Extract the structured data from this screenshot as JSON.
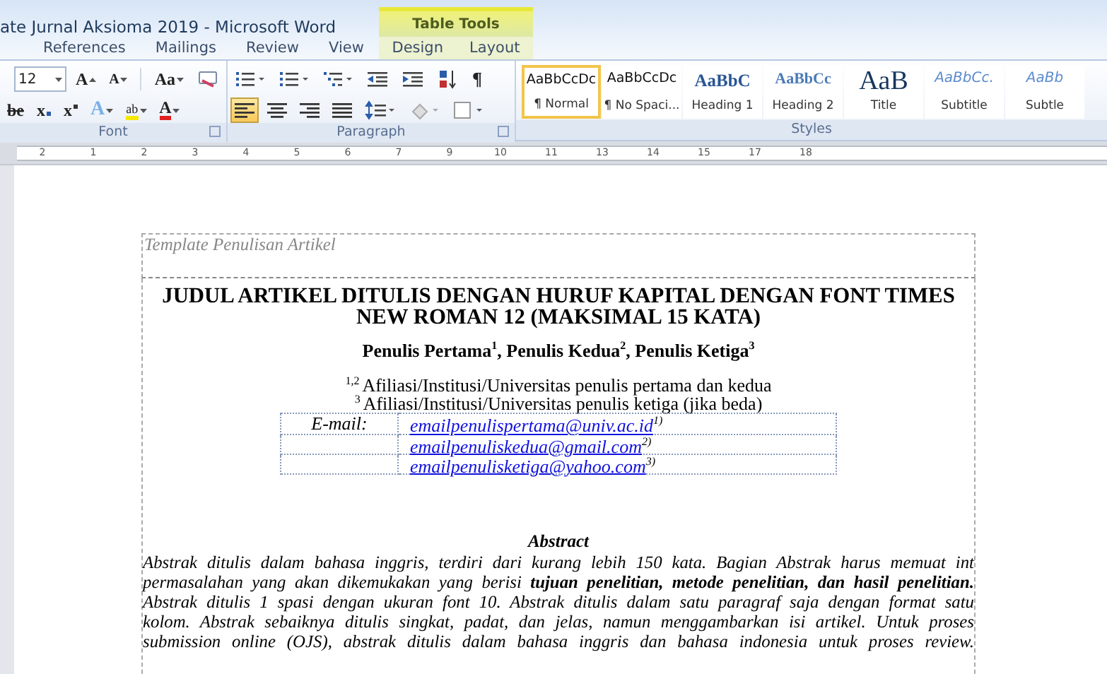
{
  "window": {
    "title": "ate Jurnal Aksioma 2019  -  Microsoft Word"
  },
  "tabs": [
    {
      "label": "References",
      "selected": false
    },
    {
      "label": "Mailings",
      "selected": false
    },
    {
      "label": "Review",
      "selected": false
    },
    {
      "label": "View",
      "selected": false
    }
  ],
  "contextual_group": {
    "label": "Table Tools",
    "tabs": [
      {
        "label": "Design",
        "selected": false
      },
      {
        "label": "Layout",
        "selected": false
      }
    ]
  },
  "font_group": {
    "label": "Font",
    "top_buttons": [
      {
        "kind": "size-field",
        "label": "12"
      },
      {
        "kind": "grow-font",
        "label": "A",
        "selected": false
      },
      {
        "kind": "shrink-font",
        "label": "A",
        "selected": false
      },
      {
        "kind": "change-case",
        "label": "Aa",
        "selected": false
      },
      {
        "kind": "clear-format",
        "selected": false
      }
    ],
    "bottom_buttons": [
      {
        "kind": "strike",
        "label": "be",
        "selected": false
      },
      {
        "kind": "subscript",
        "label": "x",
        "selected": false
      },
      {
        "kind": "superscript",
        "label": "x",
        "selected": false
      },
      {
        "kind": "text-effect",
        "label": "A",
        "selected": false
      },
      {
        "kind": "highlight",
        "label": "ab",
        "selected": false
      },
      {
        "kind": "font-color",
        "label": "A",
        "selected": false
      }
    ]
  },
  "paragraph_group": {
    "label": "Paragraph",
    "top_buttons": [
      {
        "kind": "bullets",
        "selected": false
      },
      {
        "kind": "numbering",
        "selected": false
      },
      {
        "kind": "multilevel",
        "selected": false
      },
      {
        "kind": "outdent",
        "selected": false
      },
      {
        "kind": "indent",
        "selected": false
      },
      {
        "kind": "sort",
        "selected": false
      },
      {
        "kind": "pilcrow",
        "label": "¶",
        "selected": false
      }
    ],
    "bottom_buttons": [
      {
        "kind": "align-left",
        "selected": true
      },
      {
        "kind": "align-center",
        "selected": false
      },
      {
        "kind": "align-right",
        "selected": false
      },
      {
        "kind": "justify",
        "selected": false
      },
      {
        "kind": "line-spacing",
        "selected": false
      },
      {
        "kind": "shading",
        "selected": false
      },
      {
        "kind": "borders",
        "selected": false
      }
    ]
  },
  "styles_group": {
    "label": "Styles",
    "items": [
      {
        "kind": "normal",
        "preview": "AaBbCcDc",
        "name": "¶ Normal",
        "selected": true
      },
      {
        "kind": "normal",
        "preview": "AaBbCcDc",
        "name": "¶ No Spaci...",
        "selected": false
      },
      {
        "kind": "heading1",
        "preview": "AaBbC",
        "name": "Heading 1",
        "selected": false
      },
      {
        "kind": "heading2",
        "preview": "AaBbCc",
        "name": "Heading 2",
        "selected": false
      },
      {
        "kind": "title",
        "preview": "AaB",
        "name": "Title",
        "selected": false
      },
      {
        "kind": "subtitle",
        "preview": "AaBbCc.",
        "name": "Subtitle",
        "selected": false
      },
      {
        "kind": "subtitle",
        "preview": "AaBb",
        "name": "Subtle",
        "selected": false
      }
    ]
  },
  "ruler": {
    "labels": [
      "2",
      "1",
      "2",
      "3",
      "4",
      "5",
      "6",
      "7",
      "9",
      "10",
      "11",
      "13",
      "14",
      "15",
      "17",
      "18"
    ]
  },
  "document": {
    "header": "Template Penulisan Artikel",
    "title": "JUDUL ARTIKEL DITULIS DENGAN HURUF KAPITAL DENGAN FONT TIMES NEW ROMAN 12 (MAKSIMAL 15 KATA)",
    "authors": "Penulis Pertama$^{1}$,  Penulis Kedua$^{2}$, Penulis Ketiga$^{3}$",
    "affiliations": [
      {
        "mark": "1,2",
        "text": "Afiliasi/Institusi/Universitas penulis pertama dan kedua"
      },
      {
        "mark": "3",
        "text": "Afiliasi/Institusi/Universitas penulis ketiga (jika beda)"
      }
    ],
    "email_label": "E-mail:",
    "emails": [
      {
        "address": "emailpenulispertama@univ.ac.id",
        "mark": "1)"
      },
      {
        "address": "emailpenuliskedua@gmail.com",
        "mark": "2)"
      },
      {
        "address": "emailpenulisketiga@yahoo.com",
        "mark": "3)"
      }
    ],
    "abstract_heading": "Abstract",
    "abstract_lines": [
      "Abstrak ditulis dalam bahasa inggris, terdiri dari kurang lebih 150 kata. Bagian Abstrak harus memuat int",
      "permasalahan yang akan dikemukakan yang berisi **tujuan penelitian, metode penelitian, dan hasil penelitian.**",
      "Abstrak ditulis 1 spasi dengan ukuran font 10. Abstrak ditulis dalam satu paragraf saja dengan format satu",
      "kolom. Abstrak sebaiknya ditulis singkat, padat, dan jelas, namun menggambarkan isi artikel. Untuk proses",
      "submission online (OJS), abstrak ditulis dalam bahasa inggris dan bahasa indonesia untuk proses review."
    ]
  }
}
